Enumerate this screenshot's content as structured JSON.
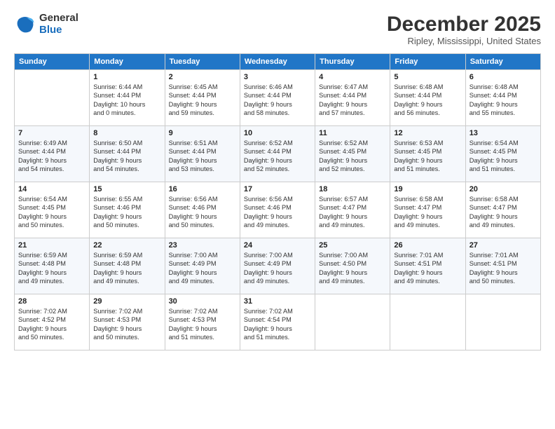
{
  "logo": {
    "line1": "General",
    "line2": "Blue"
  },
  "title": "December 2025",
  "location": "Ripley, Mississippi, United States",
  "days_of_week": [
    "Sunday",
    "Monday",
    "Tuesday",
    "Wednesday",
    "Thursday",
    "Friday",
    "Saturday"
  ],
  "weeks": [
    [
      {
        "num": "",
        "info": ""
      },
      {
        "num": "1",
        "info": "Sunrise: 6:44 AM\nSunset: 4:44 PM\nDaylight: 10 hours\nand 0 minutes."
      },
      {
        "num": "2",
        "info": "Sunrise: 6:45 AM\nSunset: 4:44 PM\nDaylight: 9 hours\nand 59 minutes."
      },
      {
        "num": "3",
        "info": "Sunrise: 6:46 AM\nSunset: 4:44 PM\nDaylight: 9 hours\nand 58 minutes."
      },
      {
        "num": "4",
        "info": "Sunrise: 6:47 AM\nSunset: 4:44 PM\nDaylight: 9 hours\nand 57 minutes."
      },
      {
        "num": "5",
        "info": "Sunrise: 6:48 AM\nSunset: 4:44 PM\nDaylight: 9 hours\nand 56 minutes."
      },
      {
        "num": "6",
        "info": "Sunrise: 6:48 AM\nSunset: 4:44 PM\nDaylight: 9 hours\nand 55 minutes."
      }
    ],
    [
      {
        "num": "7",
        "info": "Sunrise: 6:49 AM\nSunset: 4:44 PM\nDaylight: 9 hours\nand 54 minutes."
      },
      {
        "num": "8",
        "info": "Sunrise: 6:50 AM\nSunset: 4:44 PM\nDaylight: 9 hours\nand 54 minutes."
      },
      {
        "num": "9",
        "info": "Sunrise: 6:51 AM\nSunset: 4:44 PM\nDaylight: 9 hours\nand 53 minutes."
      },
      {
        "num": "10",
        "info": "Sunrise: 6:52 AM\nSunset: 4:44 PM\nDaylight: 9 hours\nand 52 minutes."
      },
      {
        "num": "11",
        "info": "Sunrise: 6:52 AM\nSunset: 4:45 PM\nDaylight: 9 hours\nand 52 minutes."
      },
      {
        "num": "12",
        "info": "Sunrise: 6:53 AM\nSunset: 4:45 PM\nDaylight: 9 hours\nand 51 minutes."
      },
      {
        "num": "13",
        "info": "Sunrise: 6:54 AM\nSunset: 4:45 PM\nDaylight: 9 hours\nand 51 minutes."
      }
    ],
    [
      {
        "num": "14",
        "info": "Sunrise: 6:54 AM\nSunset: 4:45 PM\nDaylight: 9 hours\nand 50 minutes."
      },
      {
        "num": "15",
        "info": "Sunrise: 6:55 AM\nSunset: 4:46 PM\nDaylight: 9 hours\nand 50 minutes."
      },
      {
        "num": "16",
        "info": "Sunrise: 6:56 AM\nSunset: 4:46 PM\nDaylight: 9 hours\nand 50 minutes."
      },
      {
        "num": "17",
        "info": "Sunrise: 6:56 AM\nSunset: 4:46 PM\nDaylight: 9 hours\nand 49 minutes."
      },
      {
        "num": "18",
        "info": "Sunrise: 6:57 AM\nSunset: 4:47 PM\nDaylight: 9 hours\nand 49 minutes."
      },
      {
        "num": "19",
        "info": "Sunrise: 6:58 AM\nSunset: 4:47 PM\nDaylight: 9 hours\nand 49 minutes."
      },
      {
        "num": "20",
        "info": "Sunrise: 6:58 AM\nSunset: 4:47 PM\nDaylight: 9 hours\nand 49 minutes."
      }
    ],
    [
      {
        "num": "21",
        "info": "Sunrise: 6:59 AM\nSunset: 4:48 PM\nDaylight: 9 hours\nand 49 minutes."
      },
      {
        "num": "22",
        "info": "Sunrise: 6:59 AM\nSunset: 4:48 PM\nDaylight: 9 hours\nand 49 minutes."
      },
      {
        "num": "23",
        "info": "Sunrise: 7:00 AM\nSunset: 4:49 PM\nDaylight: 9 hours\nand 49 minutes."
      },
      {
        "num": "24",
        "info": "Sunrise: 7:00 AM\nSunset: 4:49 PM\nDaylight: 9 hours\nand 49 minutes."
      },
      {
        "num": "25",
        "info": "Sunrise: 7:00 AM\nSunset: 4:50 PM\nDaylight: 9 hours\nand 49 minutes."
      },
      {
        "num": "26",
        "info": "Sunrise: 7:01 AM\nSunset: 4:51 PM\nDaylight: 9 hours\nand 49 minutes."
      },
      {
        "num": "27",
        "info": "Sunrise: 7:01 AM\nSunset: 4:51 PM\nDaylight: 9 hours\nand 50 minutes."
      }
    ],
    [
      {
        "num": "28",
        "info": "Sunrise: 7:02 AM\nSunset: 4:52 PM\nDaylight: 9 hours\nand 50 minutes."
      },
      {
        "num": "29",
        "info": "Sunrise: 7:02 AM\nSunset: 4:53 PM\nDaylight: 9 hours\nand 50 minutes."
      },
      {
        "num": "30",
        "info": "Sunrise: 7:02 AM\nSunset: 4:53 PM\nDaylight: 9 hours\nand 51 minutes."
      },
      {
        "num": "31",
        "info": "Sunrise: 7:02 AM\nSunset: 4:54 PM\nDaylight: 9 hours\nand 51 minutes."
      },
      {
        "num": "",
        "info": ""
      },
      {
        "num": "",
        "info": ""
      },
      {
        "num": "",
        "info": ""
      }
    ]
  ]
}
